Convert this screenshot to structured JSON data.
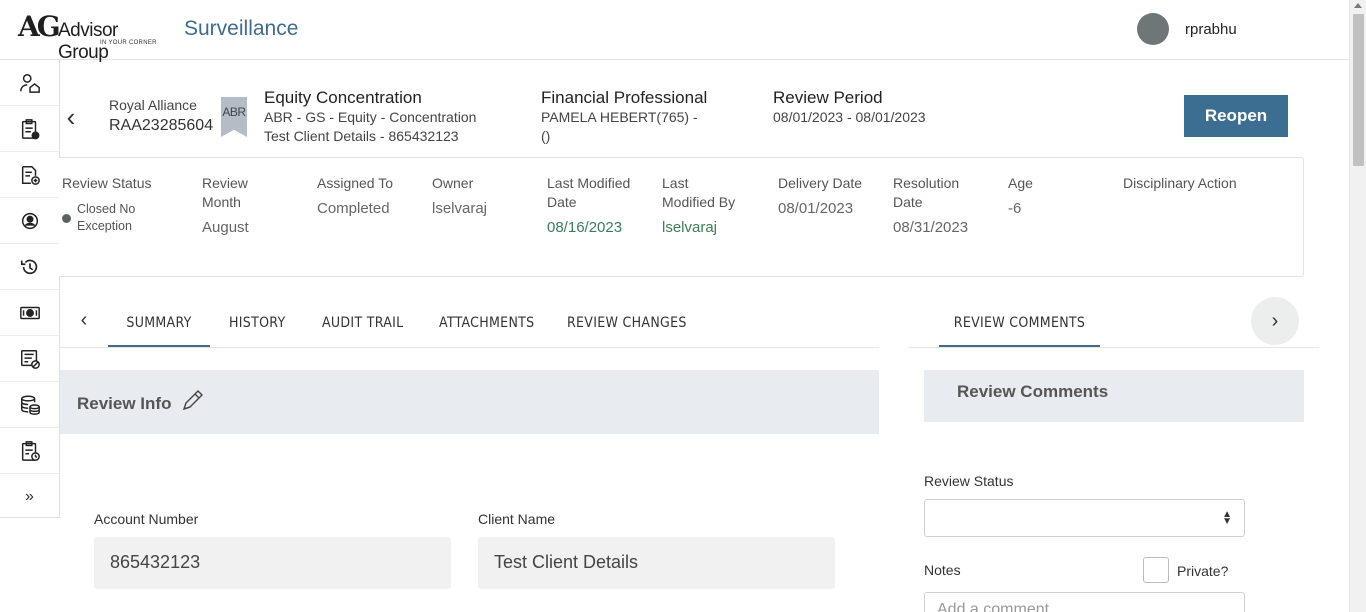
{
  "header": {
    "logo_mark": "AG",
    "logo_name": "Advisor Group",
    "logo_tagline": "IN YOUR CORNER",
    "app_title": "Surveillance",
    "username": "rprabhu"
  },
  "sidebar": {
    "items": [
      {
        "icon": "user-home-icon"
      },
      {
        "icon": "clipboard-check-icon"
      },
      {
        "icon": "document-add-icon"
      },
      {
        "icon": "user-circle-icon"
      },
      {
        "icon": "history-icon"
      },
      {
        "icon": "money-icon"
      },
      {
        "icon": "list-blocked-icon"
      },
      {
        "icon": "database-coins-icon"
      },
      {
        "icon": "clipboard-clock-icon"
      },
      {
        "icon": "expand-icon",
        "glyph": "»"
      }
    ]
  },
  "case": {
    "firm": "Royal Alliance",
    "id": "RAA23285604",
    "badge": "ABR",
    "title": "Equity Concentration",
    "subtitle1": "ABR - GS - Equity - Concentration",
    "subtitle2": "Test Client Details - 865432123",
    "fp_label": "Financial Professional",
    "fp_value1": "PAMELA HEBERT(765) -",
    "fp_value2": "()",
    "period_label": "Review Period",
    "period_value": "08/01/2023 - 08/01/2023",
    "reopen_label": "Reopen"
  },
  "meta": {
    "review_status": {
      "label": "Review Status",
      "value": "Closed No Exception"
    },
    "review_month": {
      "label": "Review Month",
      "value": "August"
    },
    "assigned_to": {
      "label": "Assigned To",
      "value": "Completed"
    },
    "owner": {
      "label": "Owner",
      "value": "lselvaraj"
    },
    "last_modified_date": {
      "label": "Last Modified Date",
      "value": "08/16/2023"
    },
    "last_modified_by": {
      "label": "Last Modified By",
      "value": "lselvaraj"
    },
    "delivery_date": {
      "label": "Delivery Date",
      "value": "08/01/2023"
    },
    "resolution_date": {
      "label": "Resolution Date",
      "value": "08/31/2023"
    },
    "age": {
      "label": "Age",
      "value": "-6"
    },
    "disciplinary_action": {
      "label": "Disciplinary Action",
      "value": ""
    }
  },
  "tabs": {
    "left": [
      "SUMMARY",
      "HISTORY",
      "AUDIT TRAIL",
      "ATTACHMENTS",
      "REVIEW CHANGES"
    ],
    "right": [
      "REVIEW COMMENTS"
    ],
    "active_left": "SUMMARY"
  },
  "review_info": {
    "title": "Review Info",
    "account_number_label": "Account Number",
    "account_number": "865432123",
    "client_name_label": "Client Name",
    "client_name": "Test Client Details"
  },
  "review_comments": {
    "title": "Review Comments",
    "status_label": "Review Status",
    "status_value": "",
    "notes_label": "Notes",
    "private_label": "Private?",
    "comment_placeholder": "Add a comment"
  },
  "colors": {
    "brand": "#3f6c8e",
    "button": "#3c6e91",
    "green": "#3b7d57",
    "panel": "#e8ecf0"
  }
}
